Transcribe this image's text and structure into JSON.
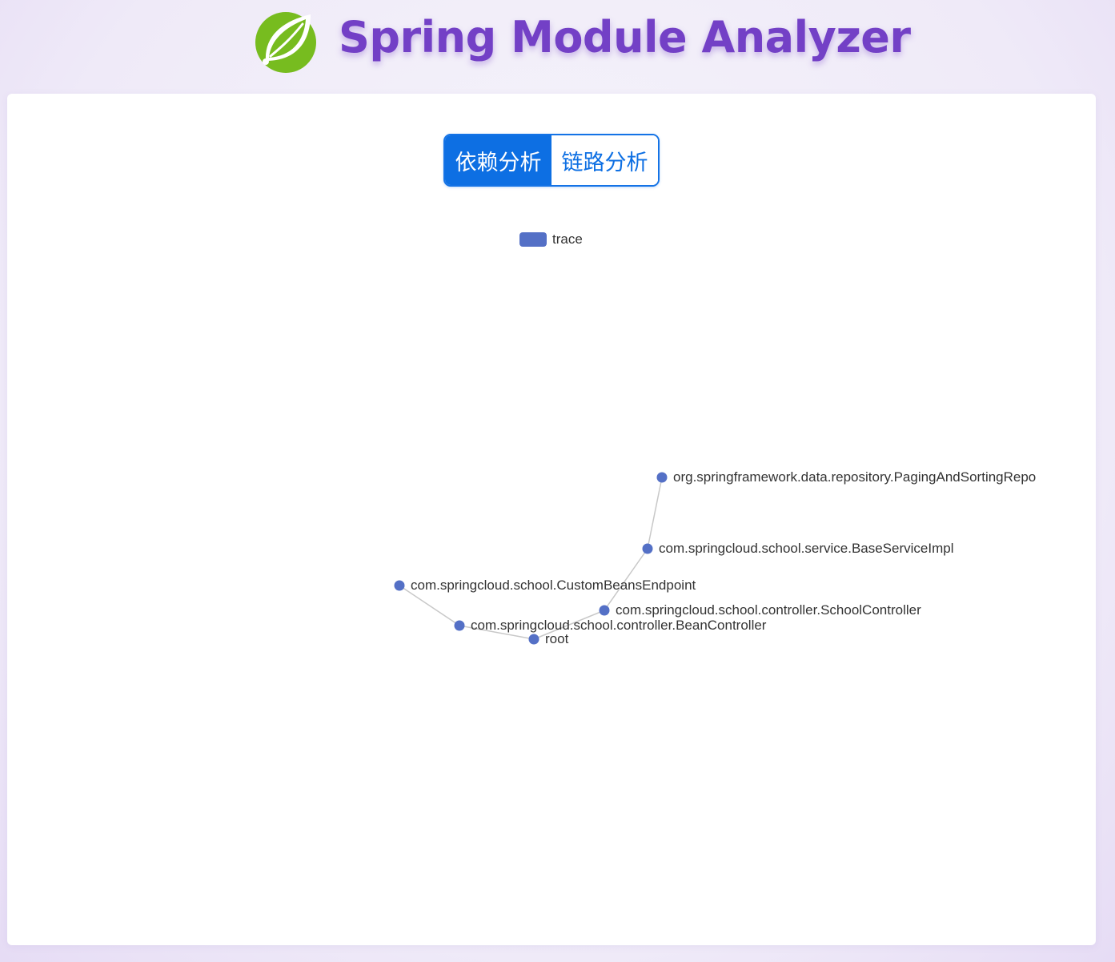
{
  "header": {
    "title": "Spring Module Analyzer",
    "logo_icon": "spring-leaf-icon",
    "logo_color": "#77bc1f",
    "title_color": "#7340c6"
  },
  "tabs": [
    {
      "label": "依赖分析",
      "active": true
    },
    {
      "label": "链路分析",
      "active": false
    }
  ],
  "accent_color": "#0d6fe3",
  "graph": {
    "legend": {
      "label": "trace",
      "color": "#5470c6"
    },
    "node_color": "#5470c6",
    "edge_color": "#c8c8c8",
    "nodes": [
      {
        "id": "root",
        "label": "root"
      },
      {
        "id": "bean",
        "label": "com.springcloud.school.controller.BeanController"
      },
      {
        "id": "custom",
        "label": "com.springcloud.school.CustomBeansEndpoint"
      },
      {
        "id": "school",
        "label": "com.springcloud.school.controller.SchoolController"
      },
      {
        "id": "base",
        "label": "com.springcloud.school.service.BaseServiceImpl"
      },
      {
        "id": "paging",
        "label": "org.springframework.data.repository.PagingAndSortingRepo"
      }
    ],
    "edges": [
      {
        "source": "root",
        "target": "bean"
      },
      {
        "source": "bean",
        "target": "custom"
      },
      {
        "source": "root",
        "target": "school"
      },
      {
        "source": "school",
        "target": "base"
      },
      {
        "source": "base",
        "target": "paging"
      }
    ]
  }
}
